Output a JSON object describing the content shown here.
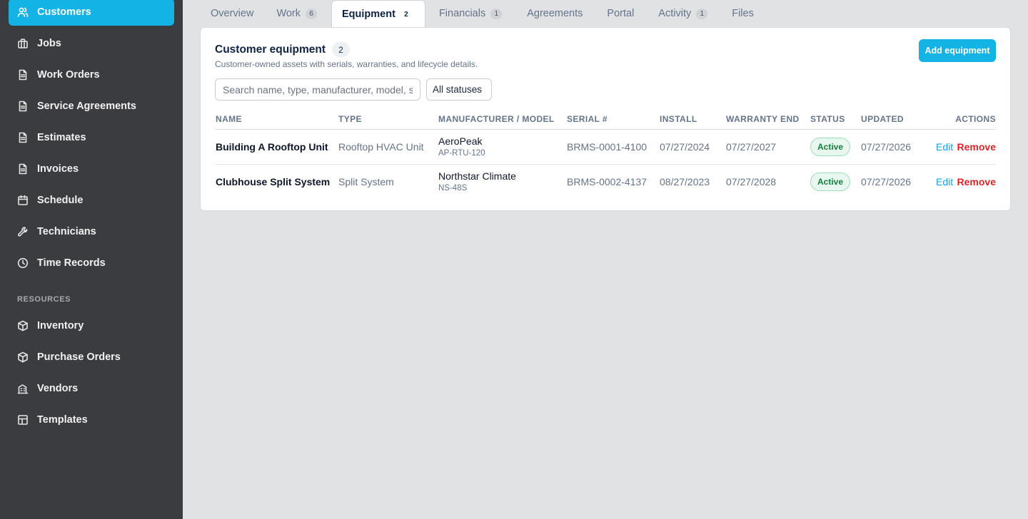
{
  "sidebar": {
    "items": [
      {
        "label": "Customers",
        "icon": "users-icon"
      },
      {
        "label": "Jobs",
        "icon": "briefcase-icon"
      },
      {
        "label": "Work Orders",
        "icon": "document-icon"
      },
      {
        "label": "Service Agreements",
        "icon": "document-icon"
      },
      {
        "label": "Estimates",
        "icon": "document-icon"
      },
      {
        "label": "Invoices",
        "icon": "document-icon"
      },
      {
        "label": "Schedule",
        "icon": "calendar-icon"
      },
      {
        "label": "Technicians",
        "icon": "wrench-icon"
      },
      {
        "label": "Time Records",
        "icon": "clock-icon"
      }
    ],
    "resources_label": "RESOURCES",
    "resources": [
      {
        "label": "Inventory",
        "icon": "box-icon"
      },
      {
        "label": "Purchase Orders",
        "icon": "box-icon"
      },
      {
        "label": "Vendors",
        "icon": "building-icon"
      },
      {
        "label": "Templates",
        "icon": "template-icon"
      }
    ],
    "accent": "#14b3e6"
  },
  "tabs": [
    {
      "label": "Overview",
      "count": null
    },
    {
      "label": "Work",
      "count": "6"
    },
    {
      "label": "Equipment",
      "count": "2"
    },
    {
      "label": "Financials",
      "count": "1"
    },
    {
      "label": "Agreements",
      "count": null
    },
    {
      "label": "Portal",
      "count": null
    },
    {
      "label": "Activity",
      "count": "1"
    },
    {
      "label": "Files",
      "count": null
    }
  ],
  "card": {
    "title": "Customer equipment",
    "count": "2",
    "subtitle": "Customer-owned assets with serials, warranties, and lifecycle details.",
    "add_button": "Add equipment",
    "search_placeholder": "Search name, type, manufacturer, model, serial",
    "status_filter": "All statuses"
  },
  "table": {
    "headers": {
      "name": "NAME",
      "type": "TYPE",
      "manufacturer": "MANUFACTURER / MODEL",
      "serial": "SERIAL #",
      "install": "INSTALL",
      "warranty": "WARRANTY END",
      "status": "STATUS",
      "updated": "UPDATED",
      "actions": "ACTIONS"
    },
    "rows": [
      {
        "name": "Building A Rooftop Unit",
        "type": "Rooftop HVAC Unit",
        "manufacturer": "AeroPeak",
        "model": "AP-RTU-120",
        "serial": "BRMS-0001-4100",
        "install": "07/27/2024",
        "warranty": "07/27/2027",
        "status": "Active",
        "updated": "07/27/2026",
        "edit": "Edit",
        "remove": "Remove"
      },
      {
        "name": "Clubhouse Split System",
        "type": "Split System",
        "manufacturer": "Northstar Climate",
        "model": "NS-48S",
        "serial": "BRMS-0002-4137",
        "install": "08/27/2023",
        "warranty": "07/27/2028",
        "status": "Active",
        "updated": "07/27/2026",
        "edit": "Edit",
        "remove": "Remove"
      }
    ]
  }
}
